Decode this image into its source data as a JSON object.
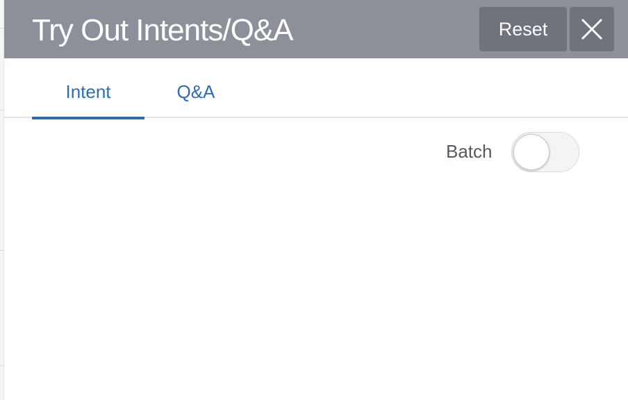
{
  "header": {
    "title": "Try Out Intents/Q&A",
    "reset_label": "Reset",
    "close_icon": "close-icon"
  },
  "tabs": [
    {
      "label": "Intent",
      "active": true
    },
    {
      "label": "Q&A",
      "active": false
    }
  ],
  "batch": {
    "label": "Batch",
    "enabled": false
  },
  "colors": {
    "header_bg": "#8c9099",
    "button_bg": "#6f737c",
    "accent": "#2f6cb2"
  }
}
